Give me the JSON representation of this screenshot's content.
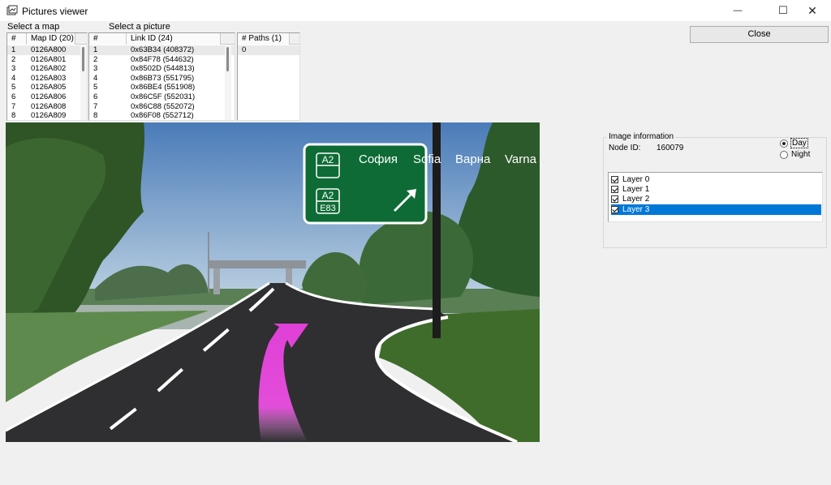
{
  "window": {
    "title": "Pictures viewer",
    "minimize_glyph": "—",
    "maximize_glyph": "☐",
    "close_glyph": "✕"
  },
  "labels": {
    "select_map": "Select a map",
    "select_picture": "Select a picture"
  },
  "maps": {
    "headers": [
      "#",
      "Map ID (20)"
    ],
    "rows": [
      [
        "1",
        "0126A800"
      ],
      [
        "2",
        "0126A801"
      ],
      [
        "3",
        "0126A802"
      ],
      [
        "4",
        "0126A803"
      ],
      [
        "5",
        "0126A805"
      ],
      [
        "6",
        "0126A806"
      ],
      [
        "7",
        "0126A808"
      ],
      [
        "8",
        "0126A809"
      ]
    ]
  },
  "links": {
    "headers": [
      "#",
      "Link ID (24)"
    ],
    "rows": [
      [
        "1",
        "0x63B34 (408372)"
      ],
      [
        "2",
        "0x84F78 (544632)"
      ],
      [
        "3",
        "0x8502D (544813)"
      ],
      [
        "4",
        "0x86B73 (551795)"
      ],
      [
        "5",
        "0x86BE4 (551908)"
      ],
      [
        "6",
        "0x86C5F (552031)"
      ],
      [
        "7",
        "0x86C88 (552072)"
      ],
      [
        "8",
        "0x86F08 (552712)"
      ]
    ]
  },
  "paths": {
    "headers": [
      "# Paths (1)"
    ],
    "rows": [
      [
        "0"
      ]
    ]
  },
  "close_button": "Close",
  "sign": {
    "shield_top": "A2",
    "shield_bottom_1": "A2",
    "shield_bottom_2": "E83",
    "dest_1": "София",
    "dest_2": "Sofia",
    "dest_3": "Варна",
    "dest_4": "Varna"
  },
  "info": {
    "group_title": "Image information",
    "node_label": "Node ID:",
    "node_value": "160079",
    "day_label": "Day",
    "night_label": "Night",
    "mode_selected": "Day",
    "layers": [
      {
        "label": "Layer 0",
        "checked": true
      },
      {
        "label": "Layer 1",
        "checked": true
      },
      {
        "label": "Layer 2",
        "checked": true
      },
      {
        "label": "Layer 3",
        "checked": true
      }
    ]
  },
  "colors": {
    "sign_green": "#0e6b36",
    "arrow_magenta": "#e040d8",
    "selection_blue": "#0078d7"
  }
}
